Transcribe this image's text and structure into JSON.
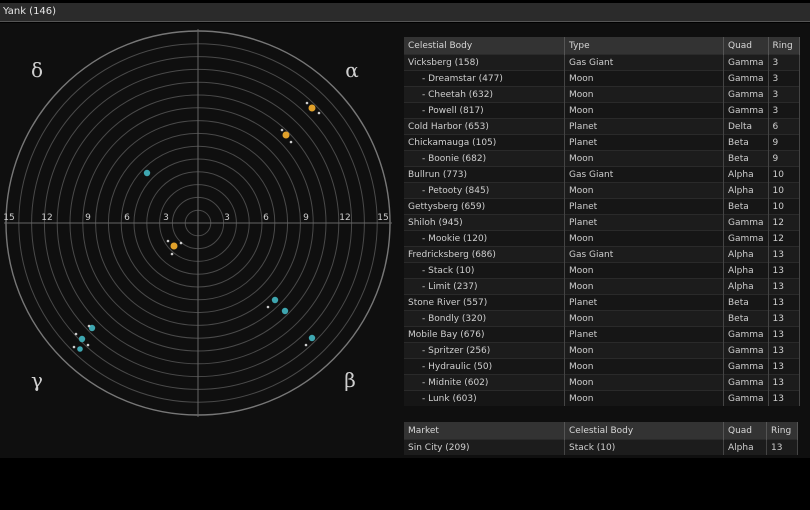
{
  "window": {
    "title": "Yank (146)"
  },
  "radar": {
    "quadrant_labels": {
      "tl": "δ",
      "tr": "α",
      "bl": "γ",
      "br": "β"
    },
    "axis_ticks": [
      "15",
      "12",
      "9",
      "6",
      "3",
      "3",
      "6",
      "9",
      "12",
      "15"
    ],
    "planet_color": "#e0a02a",
    "moon_color": "#3ea6b0"
  },
  "bodies_table": {
    "headers": [
      "Celestial Body",
      "Type",
      "Quad",
      "Ring"
    ],
    "rows": [
      {
        "name": "Vicksberg (158)",
        "type": "Gas Giant",
        "quad": "Gamma",
        "ring": "3",
        "child": false
      },
      {
        "name": "- Dreamstar (477)",
        "type": "Moon",
        "quad": "Gamma",
        "ring": "3",
        "child": true
      },
      {
        "name": "- Cheetah (632)",
        "type": "Moon",
        "quad": "Gamma",
        "ring": "3",
        "child": true
      },
      {
        "name": "- Powell (817)",
        "type": "Moon",
        "quad": "Gamma",
        "ring": "3",
        "child": true
      },
      {
        "name": "Cold Harbor (653)",
        "type": "Planet",
        "quad": "Delta",
        "ring": "6",
        "child": false
      },
      {
        "name": "Chickamauga (105)",
        "type": "Planet",
        "quad": "Beta",
        "ring": "9",
        "child": false
      },
      {
        "name": "- Boonie (682)",
        "type": "Moon",
        "quad": "Beta",
        "ring": "9",
        "child": true
      },
      {
        "name": "Bullrun (773)",
        "type": "Gas Giant",
        "quad": "Alpha",
        "ring": "10",
        "child": false
      },
      {
        "name": "- Petooty (845)",
        "type": "Moon",
        "quad": "Alpha",
        "ring": "10",
        "child": true
      },
      {
        "name": "Gettysberg (659)",
        "type": "Planet",
        "quad": "Beta",
        "ring": "10",
        "child": false
      },
      {
        "name": "Shiloh (945)",
        "type": "Planet",
        "quad": "Gamma",
        "ring": "12",
        "child": false
      },
      {
        "name": "- Mookie (120)",
        "type": "Moon",
        "quad": "Gamma",
        "ring": "12",
        "child": true
      },
      {
        "name": "Fredricksberg (686)",
        "type": "Gas Giant",
        "quad": "Alpha",
        "ring": "13",
        "child": false
      },
      {
        "name": "- Stack (10)",
        "type": "Moon",
        "quad": "Alpha",
        "ring": "13",
        "child": true
      },
      {
        "name": "- Limit (237)",
        "type": "Moon",
        "quad": "Alpha",
        "ring": "13",
        "child": true
      },
      {
        "name": "Stone River (557)",
        "type": "Planet",
        "quad": "Beta",
        "ring": "13",
        "child": false
      },
      {
        "name": "- Bondly (320)",
        "type": "Moon",
        "quad": "Beta",
        "ring": "13",
        "child": true
      },
      {
        "name": "Mobile Bay (676)",
        "type": "Planet",
        "quad": "Gamma",
        "ring": "13",
        "child": false
      },
      {
        "name": "- Spritzer (256)",
        "type": "Moon",
        "quad": "Gamma",
        "ring": "13",
        "child": true
      },
      {
        "name": "- Hydraulic (50)",
        "type": "Moon",
        "quad": "Gamma",
        "ring": "13",
        "child": true
      },
      {
        "name": "- Midnite (602)",
        "type": "Moon",
        "quad": "Gamma",
        "ring": "13",
        "child": true
      },
      {
        "name": "- Lunk (603)",
        "type": "Moon",
        "quad": "Gamma",
        "ring": "13",
        "child": true
      }
    ]
  },
  "markets_table": {
    "headers": [
      "Market",
      "Celestial Body",
      "Quad",
      "Ring"
    ],
    "rows": [
      {
        "market": "Sin City (209)",
        "body": "Stack (10)",
        "quad": "Alpha",
        "ring": "13"
      }
    ]
  }
}
